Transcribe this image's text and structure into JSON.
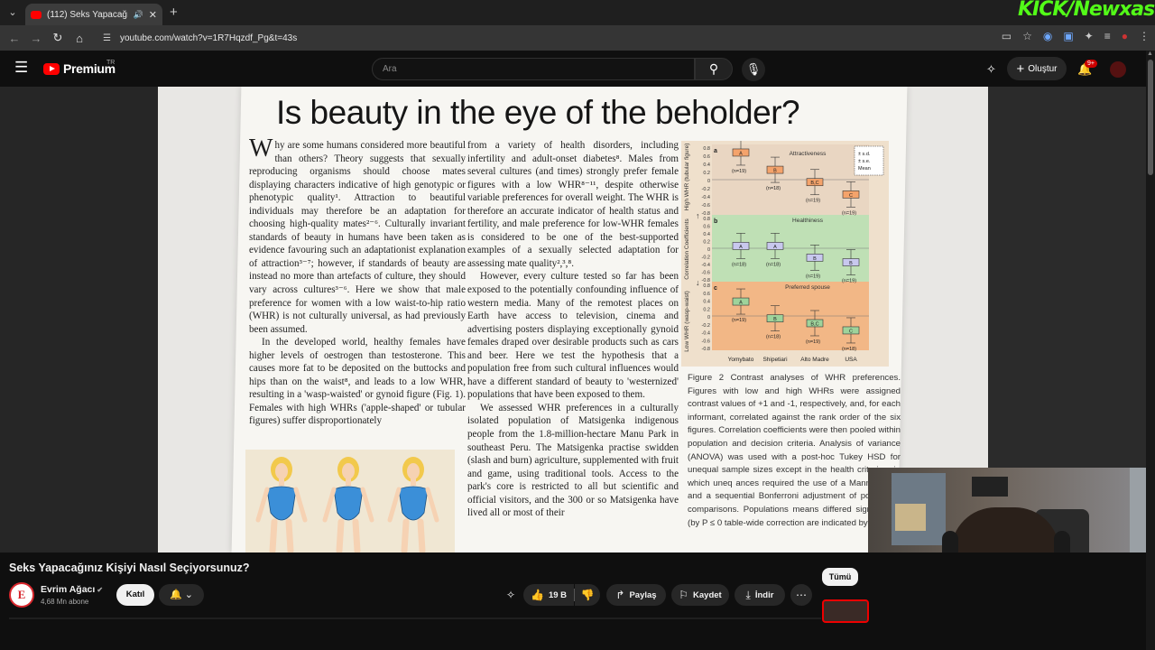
{
  "browser": {
    "tab_title": "(112) Seks Yapacağınız Kişiyi Nasıl Seçiyorsunuz?",
    "tab_audio_icon": "speaker-icon",
    "url": "youtube.com/watch?v=1R7Hqzdf_Pg&t=43s",
    "overlay_logo": "KICK/Newxas"
  },
  "youtube": {
    "logo_text": "Premium",
    "region": "TR",
    "search_placeholder": "Ara",
    "create_label": "Oluştur",
    "notification_count": "9+"
  },
  "paper": {
    "title": "Is beauty in the eye of the beholder?",
    "col1": [
      "hy are some humans considered more beautiful than others? Theory suggests that sexually reproducing organisms should choose mates displaying characters indicative of high genotypic or phenotypic quality¹. Attraction to beautiful individuals may therefore be an adaptation for choosing high-quality mates²⁻⁶. Culturally invariant standards of beauty in humans have been taken as evidence favouring such an adaptationist explanation of attraction³⁻⁷; however, if standards of beauty are instead no more than artefacts of culture, they should vary across cultures³⁻⁶. Here we show that male preference for women with a low waist-to-hip ratio (WHR) is not culturally universal, as had previously been assumed.",
      "In the developed world, healthy females have higher levels of oestrogen than testosterone. This causes more fat to be deposited on the buttocks and hips than on the waist⁸, and leads to a low WHR, resulting in a 'wasp-waisted' or gynoid figure (Fig. 1). Females with high WHRs ('apple-shaped' or tubular figures) suffer disproportionately"
    ],
    "col2": [
      "from a variety of health disorders, including infertility and adult-onset diabetes⁸. Males from several cultures (and times) strongly prefer female figures with a low WHR⁸⁻¹¹, despite otherwise variable preferences for overall weight. The WHR is therefore an accurate indicator of health status and fertility, and male preference for low-WHR females is considered to be one of the best-supported examples of a sexually selected adaptation for assessing mate quality²,³,⁸.",
      "However, every culture tested so far has been exposed to the potentially confounding influence of western media. Many of the remotest places on Earth have access to television, cinema and advertising posters displaying exceptionally gynoid females draped over desirable products such as cars and beer. Here we test the hypothesis that a population free from such cultural influences would have a different standard of beauty to 'westernized' populations that have been exposed to them.",
      "We assessed WHR preferences in a culturally isolated population of Matsigenka indigenous people from the 1.8-million-hectare Manu Park in southeast Peru. The Matsigenka practise swidden (slash and burn) agriculture, supplemented with fruit and game, using traditional tools. Access to the park's core is restricted to all but scientific and official visitors, and the 300 or so Matsigenka have lived all or most of their"
    ],
    "figure": {
      "y_axis_top": "High WHR (tubular figure)",
      "y_axis_mid": "Correlation Coefficients",
      "y_axis_bottom": "Low WHR (wasp-waist)",
      "panels": [
        {
          "letter": "a",
          "name": "Attractiveness",
          "color": "#e9d6c2"
        },
        {
          "letter": "b",
          "name": "Healthiness",
          "color": "#bfe0b5"
        },
        {
          "letter": "c",
          "name": "Preferred spouse",
          "color": "#f2b786"
        }
      ],
      "groups": [
        "Yomybato",
        "Shipetiari",
        "Alto Madre",
        "USA"
      ],
      "ticks": [
        "0.8",
        "0.6",
        "0.4",
        "0.2",
        "0",
        "-0.2",
        "-0.4",
        "-0.6",
        "-0.8"
      ],
      "legend": [
        "± s.d.",
        "± s.e.",
        "Mean"
      ],
      "box_labels": {
        "a": [
          "A",
          "B",
          "B,C",
          "C"
        ],
        "b": [
          "A",
          "A",
          "B",
          "B"
        ],
        "c": [
          "A",
          "B",
          "B,C",
          "C"
        ]
      },
      "n_labels": {
        "a": [
          "n=19",
          "n=18",
          "n=19",
          "n=19"
        ],
        "b": [
          "n=18",
          "n=18",
          "n=19",
          "n=19"
        ],
        "c": [
          "n=19",
          "n=18",
          "n=19",
          "n=18"
        ]
      }
    },
    "caption": "Figure 2 Contrast analyses of WHR preferences. Figures with low and high WHRs were assigned contrast values of +1 and -1, respectively, and, for each informant, correlated against the rank order of the six figures. Correlation coefficients were then pooled within population and decision criteria. Analysis of variance (ANOVA) was used with a post-hoc Tukey HSD for unequal sample sizes except in the health criterion, in which uneq ances required the use of a Mann-Whitne and a sequential Bonferroni adjustment of population comparisons. Populations means differed significantly (by P ≤ 0 table-wide correction are indicated by di"
  },
  "video": {
    "title": "Seks Yapacağınız Kişiyi Nasıl Seçiyorsunuz?",
    "channel_name": "Evrim Ağacı",
    "channel_initial": "E",
    "subscribers": "4,68 Mn abone",
    "join_label": "Katıl",
    "likes": "19 B",
    "share_label": "Paylaş",
    "save_label": "Kaydet",
    "download_label": "İndir",
    "chip_label": "Tümü"
  }
}
